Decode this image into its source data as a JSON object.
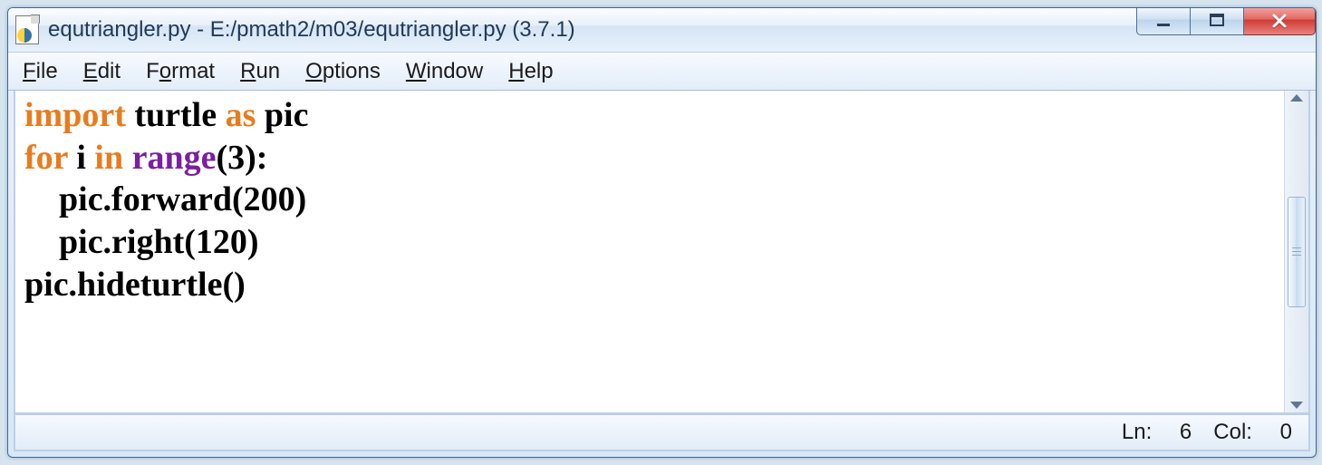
{
  "window": {
    "title": "equtriangler.py - E:/pmath2/m03/equtriangler.py (3.7.1)"
  },
  "menu": {
    "file": {
      "accel": "F",
      "rest": "ile"
    },
    "edit": {
      "accel": "E",
      "rest": "dit"
    },
    "format": {
      "pre": "F",
      "accel": "o",
      "rest": "rmat"
    },
    "run": {
      "accel": "R",
      "rest": "un"
    },
    "options": {
      "accel": "O",
      "rest": "ptions"
    },
    "window": {
      "accel": "W",
      "rest": "indow"
    },
    "help": {
      "accel": "H",
      "rest": "elp"
    }
  },
  "code": {
    "l1": {
      "import": "import",
      "sp1": " ",
      "mod": "turtle",
      "sp2": " ",
      "as": "as",
      "sp3": " ",
      "alias": "pic"
    },
    "l2": {
      "for": "for",
      "sp1": " ",
      "var": "i",
      "sp2": " ",
      "in": "in",
      "sp3": " ",
      "range": "range",
      "args": "(3):"
    },
    "l3": {
      "indent": "    ",
      "text": "pic.forward(200)"
    },
    "l4": {
      "indent": "    ",
      "text": "pic.right(120)"
    },
    "l5": {
      "text": "pic.hideturtle()"
    }
  },
  "status": {
    "ln_label": "Ln: ",
    "ln": "6",
    "col_label": "Col: ",
    "col": "0"
  }
}
